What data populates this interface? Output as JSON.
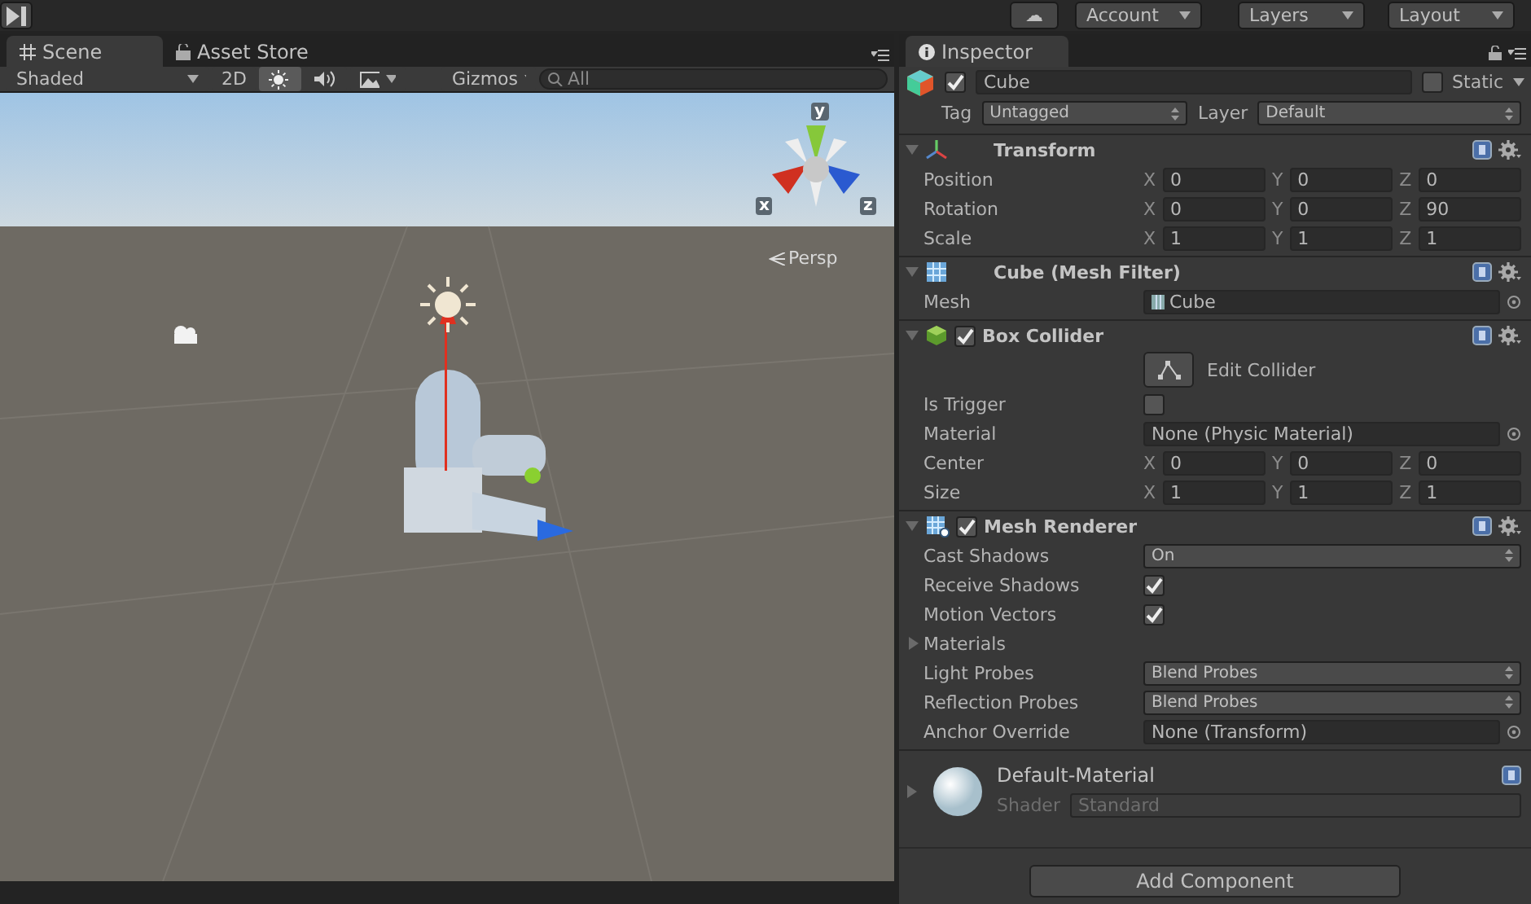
{
  "toolbar": {
    "cloud": "☁",
    "account": "Account",
    "layers": "Layers",
    "layout": "Layout"
  },
  "scene_panel": {
    "tabs": [
      {
        "label": "Scene",
        "selected": true
      },
      {
        "label": "Asset Store",
        "selected": false
      }
    ],
    "shading": "Shaded",
    "mode_2d": {
      "label": "2D",
      "on": false
    },
    "lighting_on": true,
    "audio_on": false,
    "gizmos": "Gizmos",
    "search": {
      "placeholder": "All"
    },
    "axis_labels": [
      "y",
      "x",
      "z"
    ],
    "projection": "Persp"
  },
  "inspector": {
    "tab": "Inspector",
    "object": {
      "active": true,
      "name": "Cube",
      "static_label": "Static",
      "static": false,
      "tag_label": "Tag",
      "tag": "Untagged",
      "layer_label": "Layer",
      "layer": "Default"
    },
    "components": [
      {
        "title": "Transform",
        "kind": "axes",
        "expanded": true,
        "rows": [
          {
            "kind": "vector",
            "label": "Position",
            "fields": [
              {
                "axis": "X",
                "value": "0"
              },
              {
                "axis": "Y",
                "value": "0"
              },
              {
                "axis": "Z",
                "value": "0"
              }
            ]
          },
          {
            "kind": "vector",
            "label": "Rotation",
            "fields": [
              {
                "axis": "X",
                "value": "0"
              },
              {
                "axis": "Y",
                "value": "0"
              },
              {
                "axis": "Z",
                "value": "90"
              }
            ]
          },
          {
            "kind": "vector",
            "label": "Scale",
            "fields": [
              {
                "axis": "X",
                "value": "1"
              },
              {
                "axis": "Y",
                "value": "1"
              },
              {
                "axis": "Z",
                "value": "1"
              }
            ]
          }
        ]
      },
      {
        "title": "Cube (Mesh Filter)",
        "kind": "grid",
        "expanded": true,
        "rows": [
          {
            "kind": "object",
            "label": "Mesh",
            "value": "Cube",
            "asset_icon": true
          }
        ]
      },
      {
        "title": "Box Collider",
        "kind": "cube",
        "enabled": true,
        "expanded": true,
        "rows": [
          {
            "kind": "button",
            "label": "Edit Collider"
          },
          {
            "kind": "checkbox",
            "label": "Is Trigger",
            "checked": false
          },
          {
            "kind": "object",
            "label": "Material",
            "value": "None (Physic Material)",
            "asset_icon": false
          },
          {
            "kind": "vector",
            "label": "Center",
            "fields": [
              {
                "axis": "X",
                "value": "0"
              },
              {
                "axis": "Y",
                "value": "0"
              },
              {
                "axis": "Z",
                "value": "0"
              }
            ]
          },
          {
            "kind": "vector",
            "label": "Size",
            "fields": [
              {
                "axis": "X",
                "value": "1"
              },
              {
                "axis": "Y",
                "value": "1"
              },
              {
                "axis": "Z",
                "value": "1"
              }
            ]
          }
        ]
      },
      {
        "title": "Mesh Renderer",
        "kind": "renderer",
        "enabled": true,
        "expanded": true,
        "rows": [
          {
            "kind": "dropdown",
            "label": "Cast Shadows",
            "value": "On"
          },
          {
            "kind": "checkbox",
            "label": "Receive Shadows",
            "checked": true
          },
          {
            "kind": "checkbox",
            "label": "Motion Vectors",
            "checked": true
          },
          {
            "kind": "foldout",
            "label": "Materials",
            "expanded": false
          },
          {
            "kind": "dropdown",
            "label": "Light Probes",
            "value": "Blend Probes"
          },
          {
            "kind": "dropdown",
            "label": "Reflection Probes",
            "value": "Blend Probes"
          },
          {
            "kind": "object",
            "label": "Anchor Override",
            "value": "None (Transform)",
            "asset_icon": false
          }
        ]
      }
    ],
    "material": {
      "name": "Default-Material",
      "shader_label": "Shader",
      "shader": "Standard",
      "expanded": false
    },
    "add_component": "Add Component"
  }
}
